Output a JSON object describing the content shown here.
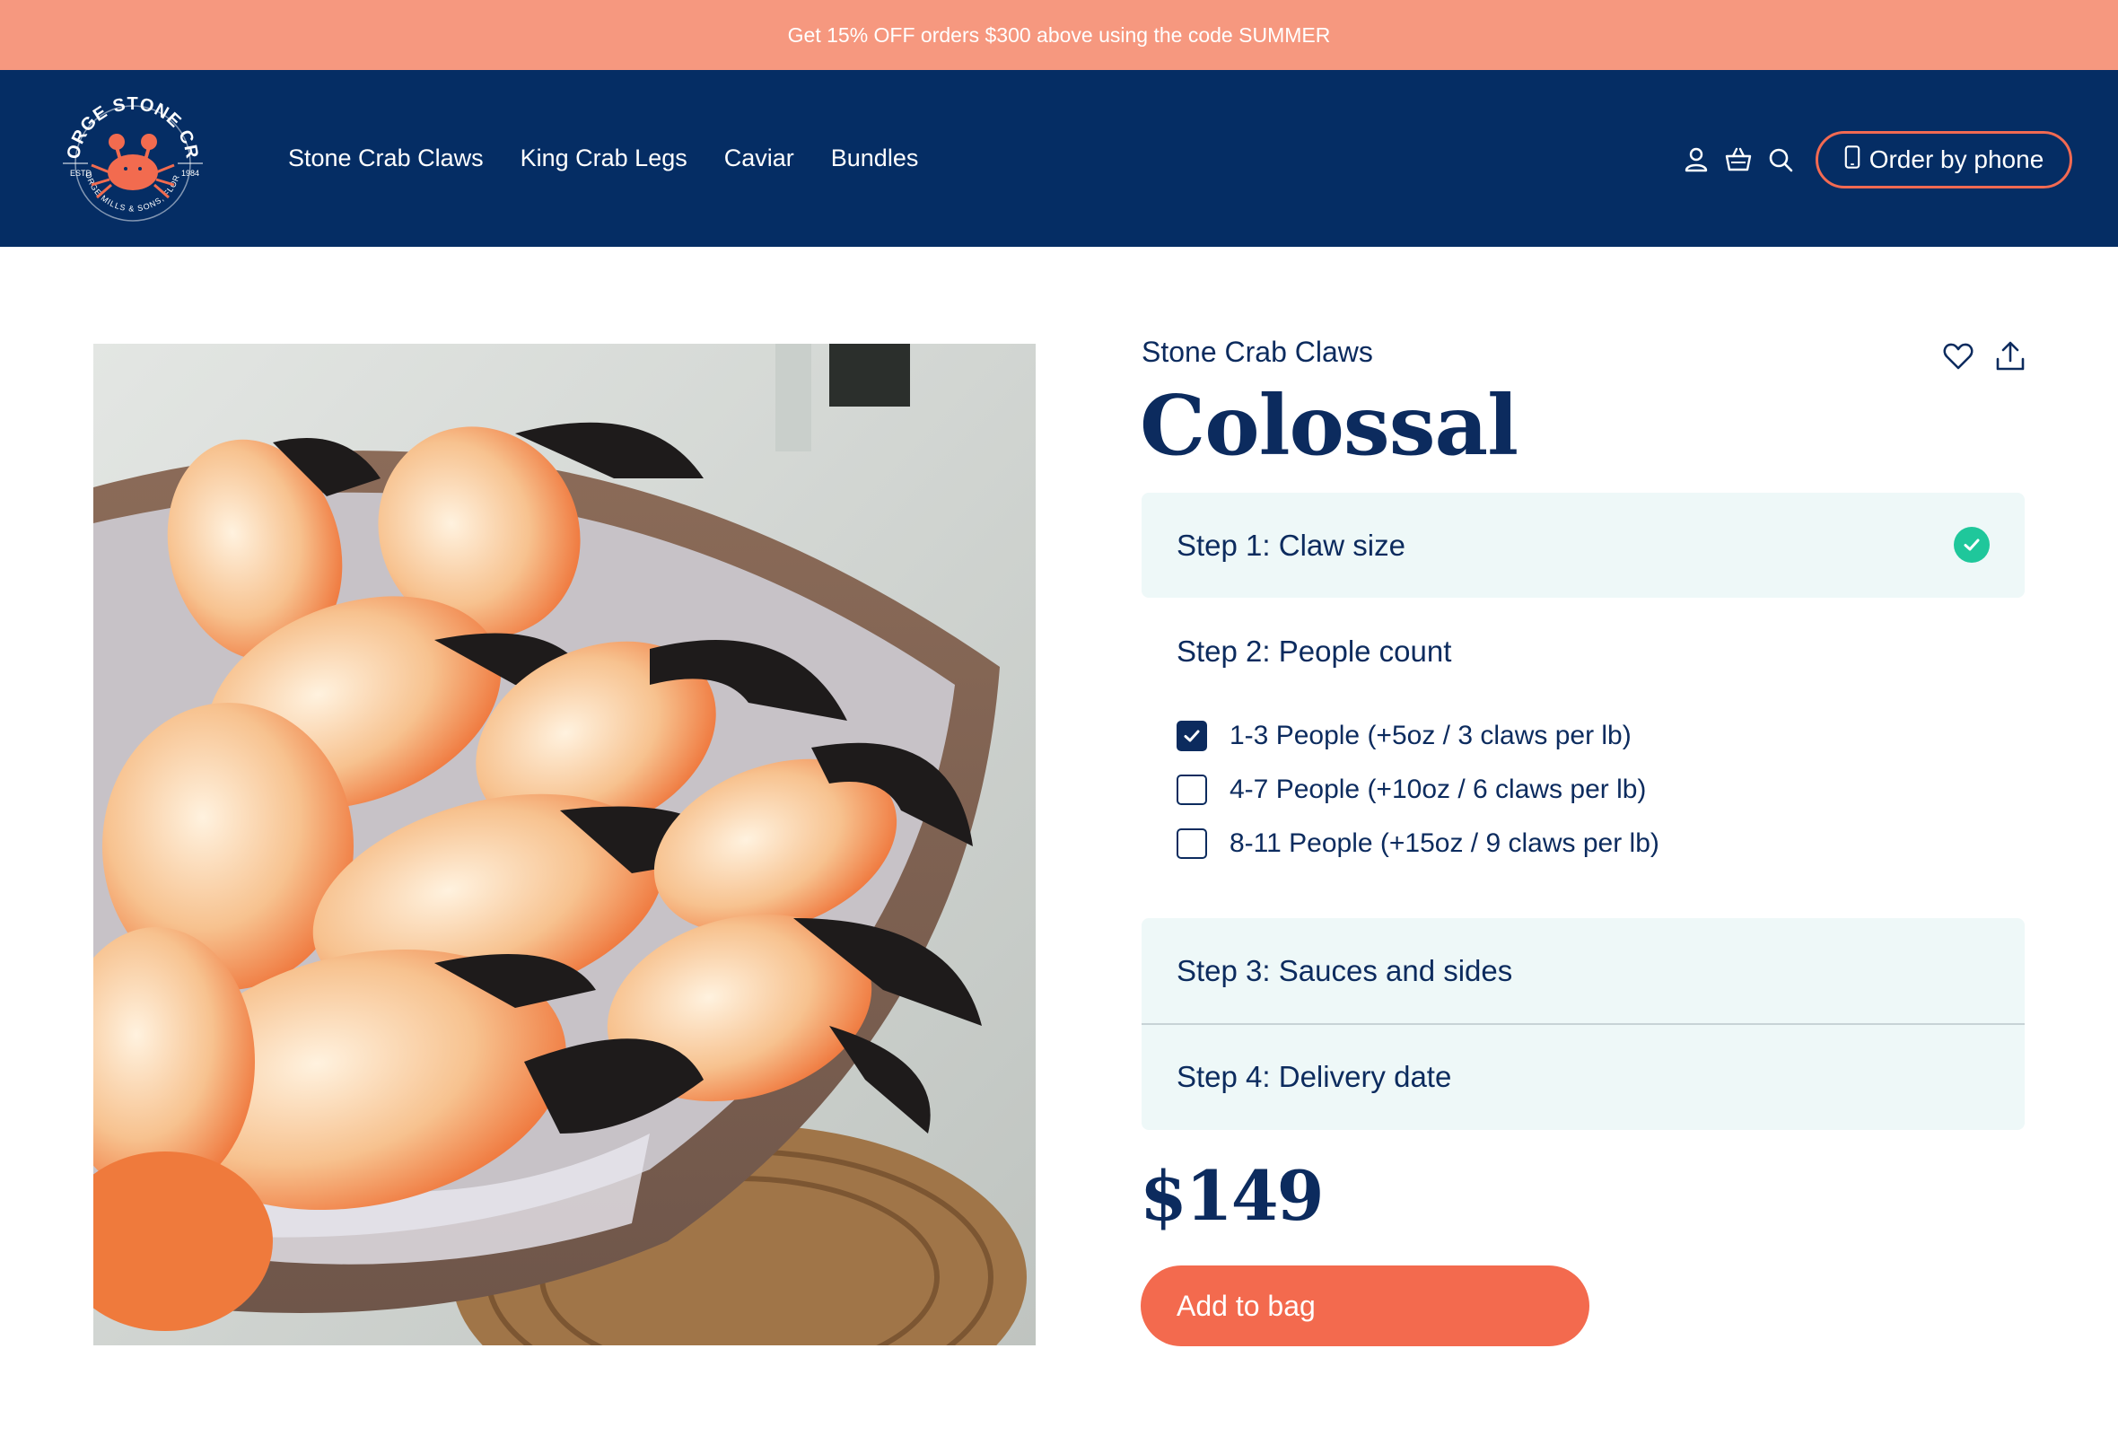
{
  "promo": {
    "text": "Get 15% OFF orders $300 above using the code SUMMER"
  },
  "brand": {
    "name": "GEORGE STONE CRAB",
    "est": "ESTD",
    "year": "1984",
    "tagline": "GEORGE MILLS & SONS, FLORIDA"
  },
  "nav": {
    "items": [
      {
        "label": "Stone Crab Claws"
      },
      {
        "label": "King Crab Legs"
      },
      {
        "label": "Caviar"
      },
      {
        "label": "Bundles"
      }
    ]
  },
  "header": {
    "icons": [
      "user-icon",
      "basket-icon",
      "search-icon"
    ],
    "phone_button": "Order by phone"
  },
  "product": {
    "category": "Stone Crab Claws",
    "name": "Colossal",
    "price": "$149",
    "add_button": "Add to bag",
    "icons": [
      "heart-icon",
      "share-icon"
    ]
  },
  "steps": {
    "step1": {
      "label": "Step 1: Claw size",
      "complete": true
    },
    "step2": {
      "label": "Step 2: People count",
      "options": [
        {
          "label": "1-3 People (+5oz / 3 claws per lb)",
          "checked": true
        },
        {
          "label": "4-7 People (+10oz / 6 claws per lb)",
          "checked": false
        },
        {
          "label": "8-11 People (+15oz / 9 claws per lb)",
          "checked": false
        }
      ]
    },
    "step3": {
      "label": "Step 3: Sauces and sides"
    },
    "step4": {
      "label": "Step 4: Delivery date"
    }
  },
  "colors": {
    "navy": "#052d64",
    "promo": "#f6987f",
    "accent": "#f36a4e",
    "panel": "#eef8f8",
    "success": "#1fc79b"
  }
}
